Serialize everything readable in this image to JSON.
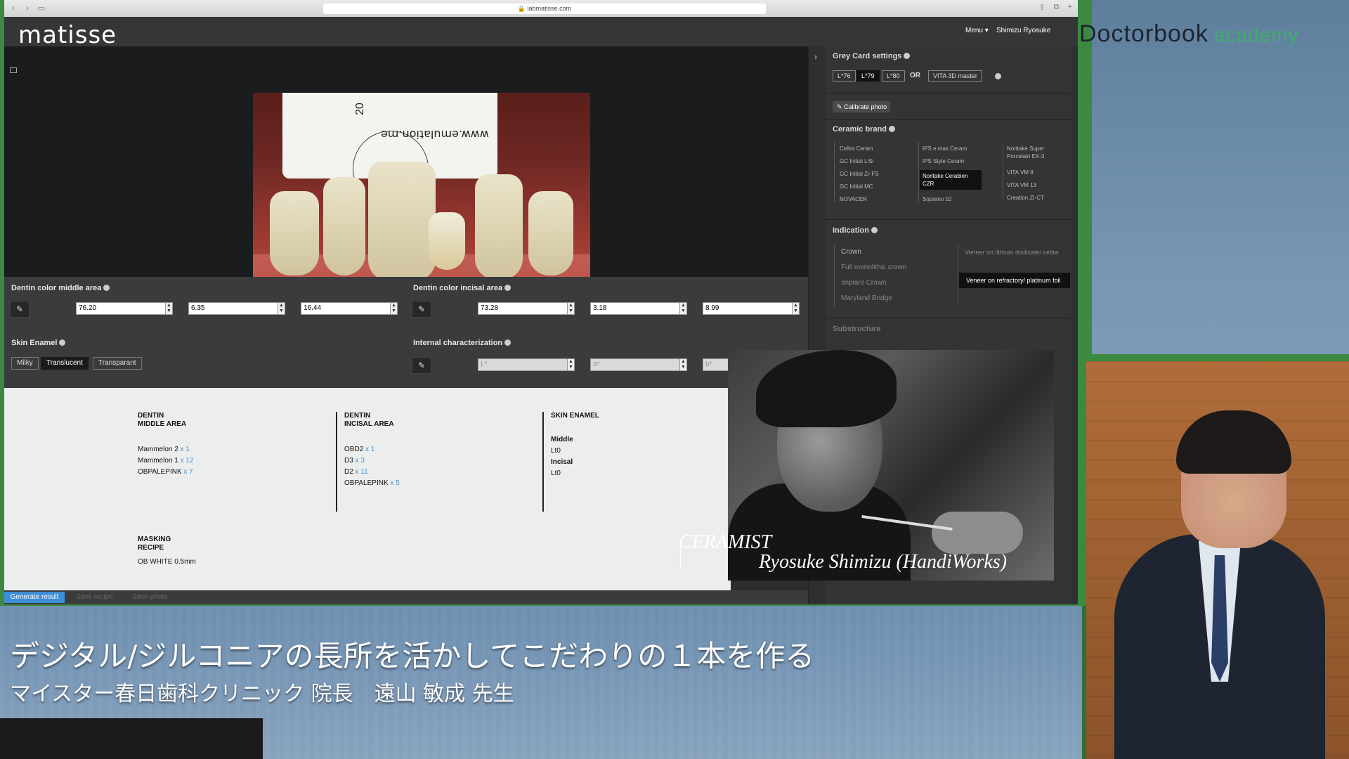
{
  "browser": {
    "url": "labmatisse.com"
  },
  "app": {
    "logo": "matisse",
    "menu_label": "Menu",
    "menu_caret": "▾",
    "user": "Shimizu Ryosuke"
  },
  "photo": {
    "card_text": "www.emulation.me",
    "card_number": "20"
  },
  "dentin_middle": {
    "label": "Dentin color middle area",
    "values": [
      "76.20",
      "6.35",
      "16.44"
    ]
  },
  "dentin_incisal": {
    "label": "Dentin color incisal area",
    "values": [
      "73.28",
      "3.18",
      "8.99"
    ]
  },
  "skin_enamel": {
    "label": "Skin Enamel",
    "options": [
      "Milky",
      "Translucent",
      "Transparant"
    ],
    "selected": "Translucent"
  },
  "internal_characterization": {
    "label": "Internal characterization",
    "placeholders": [
      "L*",
      "a*",
      "b*"
    ]
  },
  "recipe": {
    "col1_title": [
      "DENTIN",
      "MIDDLE AREA"
    ],
    "col1_items": [
      {
        "name": "Mammelon 2",
        "qty": "x 1"
      },
      {
        "name": "Mammelon 1",
        "qty": "x 12"
      },
      {
        "name": "OBPALEPINK",
        "qty": "x 7"
      }
    ],
    "col2_title": [
      "DENTIN",
      "INCISAL AREA"
    ],
    "col2_items": [
      {
        "name": "OBD2",
        "qty": "x 1"
      },
      {
        "name": "D3",
        "qty": "x 3"
      },
      {
        "name": "D2",
        "qty": "x 11"
      },
      {
        "name": "OBPALEPINK",
        "qty": "x 5"
      }
    ],
    "col3_title": "SKIN ENAMEL",
    "col3_lines": [
      "Middle",
      "Lt0",
      "Incisal",
      "Lt0"
    ],
    "masking_title": [
      "MASKING",
      "RECIPE"
    ],
    "masking_value": "OB WHITE 0.5mm"
  },
  "bottom_bar": {
    "generate": "Generate result",
    "save_recipe": "Save recipe",
    "save_photo": "Save photo"
  },
  "settings": {
    "grey_card_title": "Grey Card settings",
    "l_options": [
      "L*76",
      "L*79",
      "L*80"
    ],
    "l_selected": "L*79",
    "or_label": "OR",
    "vita_label": "VITA 3D master",
    "calibrate": "Calibrate photo",
    "ceramic_title": "Ceramic brand",
    "brands_col1": [
      "Celtra Ceram",
      "GC Initial LiSi",
      "GC Initial Zr-FS",
      "GC Initial MC",
      "NOVACER"
    ],
    "brands_col2": [
      "IPS e.max Ceram",
      "IPS Style Ceram",
      "Noritake Cerabien CZR",
      "Soprano 10"
    ],
    "brands_col3": [
      "Noritake Super Porcelain EX-3",
      "VITA VM 9",
      "VITA VM 13",
      "Creation ZI-CT"
    ],
    "brand_selected": "Noritake Cerabien CZR",
    "indication_title": "Indication",
    "indication_col1": [
      "Crown",
      "Full monolithic crown",
      "Implant Crown",
      "Maryland Bridge"
    ],
    "indication_col2": [
      "Veneer on lithium disilicate/ celtra",
      "Veneer on refractory/ platinum foil"
    ],
    "indication_selected": "Veneer on refractory/ platinum foil",
    "substructure_title": "Substructure"
  },
  "overlay": {
    "ceramist_label": "CERAMIST",
    "ceramist_name": "Ryosuke Shimizu  (HandiWorks)"
  },
  "brand": {
    "name": "Doctorbook",
    "sub": "academy"
  },
  "caption": {
    "title": "デジタル/ジルコニアの長所を活かしてこだわりの１本を作る",
    "subtitle": "マイスター春日歯科クリニック 院長　遠山 敏成 先生"
  },
  "colors": {
    "accent_blue": "#3d8ed6",
    "frame_green": "#3b8a3f",
    "quantity_blue": "#4a90c9"
  }
}
